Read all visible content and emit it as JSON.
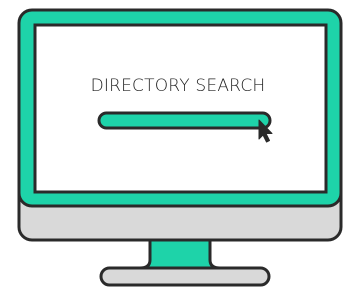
{
  "screen": {
    "title": "DIRECTORY SEARCH",
    "search": {
      "value": ""
    }
  },
  "colors": {
    "accent": "#1ED3A9",
    "outline": "#2A2A2A",
    "monitor_base": "#D9D9D9",
    "screen_bg": "#FFFFFF"
  },
  "icons": {
    "cursor": "arrow-cursor-icon"
  }
}
